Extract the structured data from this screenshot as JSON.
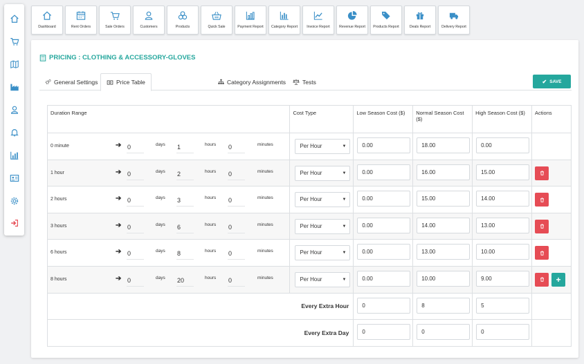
{
  "sidebar": {
    "items": [
      "home-icon",
      "cart-icon",
      "map-icon",
      "factory-icon",
      "user-icon",
      "bell-icon",
      "chart-icon",
      "id-card-icon",
      "gear-icon",
      "logout-icon"
    ]
  },
  "topbar": {
    "items": [
      {
        "label": "Dashboard",
        "icon": "home-icon"
      },
      {
        "label": "Rent Orders",
        "icon": "calendar-icon"
      },
      {
        "label": "Sale Orders",
        "icon": "cart-icon"
      },
      {
        "label": "Customers",
        "icon": "user-icon"
      },
      {
        "label": "Products",
        "icon": "cubes-icon"
      },
      {
        "label": "Quick Sale",
        "icon": "basket-icon"
      },
      {
        "label": "Payment Report",
        "icon": "bar-chart-icon"
      },
      {
        "label": "Category Report",
        "icon": "bar-chart-icon"
      },
      {
        "label": "Invoice Report",
        "icon": "line-chart-icon"
      },
      {
        "label": "Revenue Report",
        "icon": "pie-chart-icon"
      },
      {
        "label": "Products Report",
        "icon": "tags-icon"
      },
      {
        "label": "Deals Report",
        "icon": "gift-icon"
      },
      {
        "label": "Delivery Report",
        "icon": "truck-icon"
      }
    ]
  },
  "page": {
    "title": "PRICING : CLOTHING & ACCESSORY-GLOVES",
    "accent": "#25a79d",
    "danger": "#e64c55"
  },
  "tabs": [
    {
      "label": "General Settings",
      "icon": "gears-icon",
      "active": false
    },
    {
      "label": "Price Table",
      "icon": "money-icon",
      "active": true
    },
    {
      "label": "Category Assignments",
      "icon": "sitemap-icon",
      "active": false
    },
    {
      "label": "Tests",
      "icon": "balance-icon",
      "active": false
    }
  ],
  "save_label": "SAVE",
  "table": {
    "headers": {
      "duration": "Duration Range",
      "cost_type": "Cost Type",
      "low": "Low Season Cost ($)",
      "normal": "Normal Season Cost ($)",
      "high": "High Season Cost ($)",
      "actions": "Actions"
    },
    "units": {
      "days": "days",
      "hours": "hours",
      "minutes": "minutes"
    },
    "rows": [
      {
        "label": "0 minute",
        "days": "0",
        "hours": "1",
        "minutes": "0",
        "cost_type": "Per Hour",
        "low": "0.00",
        "normal": "18.00",
        "high": "0.00",
        "delete": false,
        "add": false
      },
      {
        "label": "1 hour",
        "days": "0",
        "hours": "2",
        "minutes": "0",
        "cost_type": "Per Hour",
        "low": "0.00",
        "normal": "16.00",
        "high": "15.00",
        "delete": true,
        "add": false
      },
      {
        "label": "2 hours",
        "days": "0",
        "hours": "3",
        "minutes": "0",
        "cost_type": "Per Hour",
        "low": "0.00",
        "normal": "15.00",
        "high": "14.00",
        "delete": true,
        "add": false
      },
      {
        "label": "3 hours",
        "days": "0",
        "hours": "6",
        "minutes": "0",
        "cost_type": "Per Hour",
        "low": "0.00",
        "normal": "14.00",
        "high": "13.00",
        "delete": true,
        "add": false
      },
      {
        "label": "6 hours",
        "days": "0",
        "hours": "8",
        "minutes": "0",
        "cost_type": "Per Hour",
        "low": "0.00",
        "normal": "13.00",
        "high": "10.00",
        "delete": true,
        "add": false
      },
      {
        "label": "8 hours",
        "days": "0",
        "hours": "20",
        "minutes": "0",
        "cost_type": "Per Hour",
        "low": "0.00",
        "normal": "10.00",
        "high": "9.00",
        "delete": true,
        "add": true
      }
    ],
    "extra": [
      {
        "label": "Every Extra Hour",
        "low": "0",
        "normal": "8",
        "high": "5"
      },
      {
        "label": "Every Extra Day",
        "low": "0",
        "normal": "0",
        "high": "0"
      }
    ]
  }
}
